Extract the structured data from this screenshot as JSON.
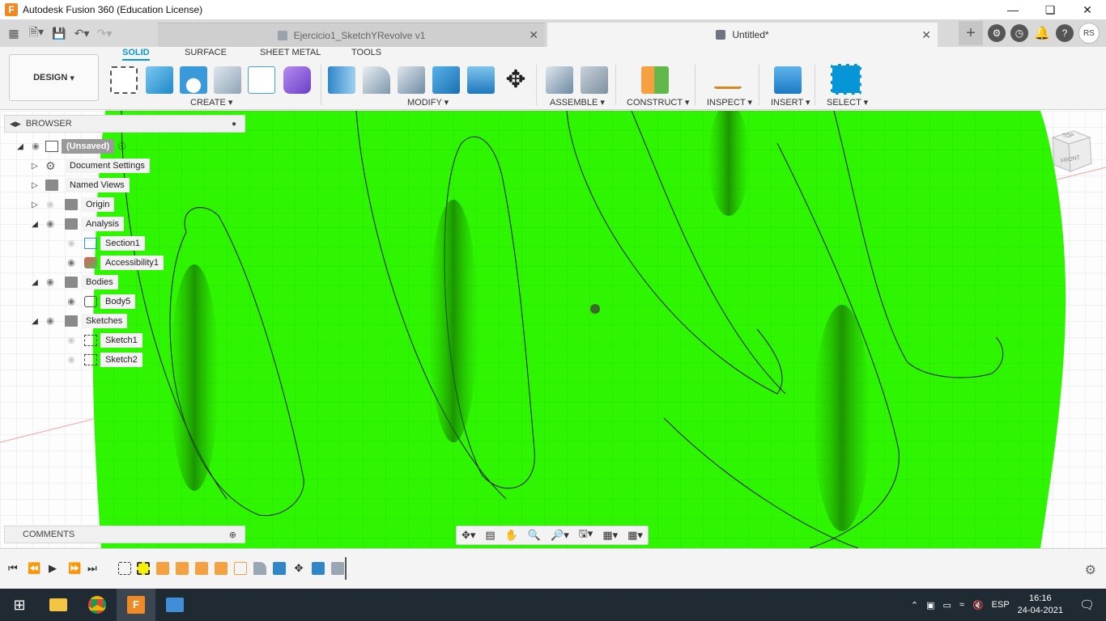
{
  "window": {
    "title": "Autodesk Fusion 360 (Education License)",
    "app_icon_letter": "F"
  },
  "tabs": [
    {
      "label": "Ejercicio1_SketchYRevolve v1",
      "active": false
    },
    {
      "label": "Untitled*",
      "active": true
    }
  ],
  "user_initials": "RS",
  "toolbar": {
    "design_label": "DESIGN",
    "workspace_tabs": [
      "SOLID",
      "SURFACE",
      "SHEET METAL",
      "TOOLS"
    ],
    "groups": [
      "CREATE",
      "MODIFY",
      "ASSEMBLE",
      "CONSTRUCT",
      "INSPECT",
      "INSERT",
      "SELECT"
    ]
  },
  "browser": {
    "title": "BROWSER",
    "items": [
      {
        "label": "(Unsaved)"
      },
      {
        "label": "Document Settings"
      },
      {
        "label": "Named Views"
      },
      {
        "label": "Origin"
      },
      {
        "label": "Analysis"
      },
      {
        "label": "Section1"
      },
      {
        "label": "Accessibility1"
      },
      {
        "label": "Bodies"
      },
      {
        "label": "Body5"
      },
      {
        "label": "Sketches"
      },
      {
        "label": "Sketch1"
      },
      {
        "label": "Sketch2"
      }
    ]
  },
  "comments_title": "COMMENTS",
  "viewcube": {
    "top": "TOP",
    "front": "FRONT"
  },
  "taskbar": {
    "time": "16:16",
    "date": "24-04-2021",
    "language": "ESP"
  },
  "colors": {
    "accent": "#0696d7",
    "model_green": "#2ef500",
    "taskbar_bg": "#1f2a33"
  }
}
